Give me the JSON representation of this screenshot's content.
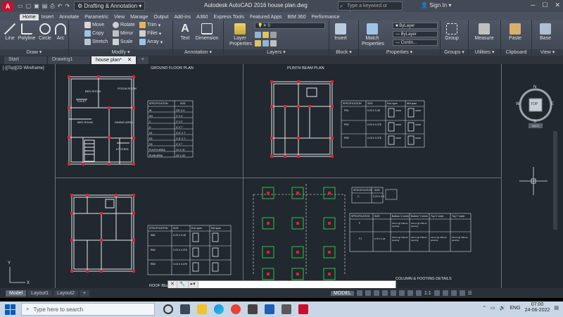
{
  "titlebar": {
    "app_logo": "A",
    "workspace": "Drafting & Annotation",
    "title": "Autodesk AutoCAD 2016    house plan.dwg",
    "search_placeholder": "Type a keyword or phrase",
    "sign_in": "Sign In"
  },
  "ribbon_tabs": [
    "Home",
    "Insert",
    "Annotate",
    "Parametric",
    "View",
    "Manage",
    "Output",
    "Add-ins",
    "A360",
    "Express Tools",
    "Featured Apps",
    "BIM 360",
    "Performance"
  ],
  "ribbon": {
    "draw": {
      "title": "Draw",
      "line": "Line",
      "polyline": "Polyline",
      "circle": "Circle",
      "arc": "Arc"
    },
    "modify": {
      "title": "Modify",
      "move": "Move",
      "copy": "Copy",
      "stretch": "Stretch",
      "rotate": "Rotate",
      "mirror": "Mirror",
      "scale": "Scale",
      "trim": "Trim",
      "fillet": "Fillet",
      "array": "Array"
    },
    "annotation": {
      "title": "Annotation",
      "text": "Text",
      "dimension": "Dimension"
    },
    "layers": {
      "title": "Layers",
      "layer_properties": "Layer Properties",
      "current_layer": "0"
    },
    "block": {
      "title": "Block",
      "insert": "Insert"
    },
    "properties": {
      "title": "Properties",
      "match": "Match Properties",
      "color": "ByLayer",
      "lineweight": "ByLayer",
      "linetype": "Contin..."
    },
    "groups": {
      "title": "Groups",
      "group": "Group"
    },
    "utilities": {
      "title": "Utilities",
      "measure": "Measure"
    },
    "clipboard": {
      "title": "Clipboard",
      "paste": "Paste"
    },
    "view": {
      "title": "View",
      "base": "Base"
    }
  },
  "file_tabs": [
    "Start",
    "Drawing1",
    "house plan*"
  ],
  "canvas": {
    "viewport_label": "[-][Top][2D Wireframe]",
    "titles": {
      "ground": "GROUND FLOOR PLAN",
      "plinth": "PLINTH BEAM PLAN",
      "roof": "ROOF BEAM PLAN",
      "column": "COLUMN & FOOTING DETAILS"
    },
    "rooms": {
      "bed_room": "BED ROOM",
      "pooja": "POOJA ROOM",
      "toilet": "TOILET",
      "bed_room2": "BED ROOM",
      "dining": "DINING AREA",
      "kitchen": "KITCHEN"
    },
    "ground_table": {
      "headers": [
        "SPECIFICATION",
        "SIZE"
      ],
      "rows": [
        [
          "W",
          "2'6\" X 4'"
        ],
        [
          "W1",
          "2' X 4'"
        ],
        [
          "V",
          "2' X 2'"
        ],
        [
          "D",
          "3' X 7'"
        ],
        [
          "D1",
          "3'-6\" X 7'"
        ],
        [
          "D2",
          "2'-6\" X 7'"
        ],
        [
          "D3",
          "3' X 7'"
        ],
        [
          "PLINTH AREA",
          "24' X 31'"
        ],
        [
          "SLAB AREA",
          "25' X 32'"
        ]
      ]
    },
    "beam_table": {
      "headers": [
        "SPECIFICATION",
        "SIZE",
        "End span",
        "Mid span"
      ],
      "rows": [
        [
          "PB1",
          "0.23 X 0.45"
        ],
        [
          "PB2",
          "0.23 X 0.375"
        ],
        [
          "PB3",
          "0.15 X 0.375"
        ]
      ]
    },
    "roof_table": {
      "headers": [
        "SPECIFICATION",
        "SIZE",
        "End span",
        "Mid span"
      ],
      "rows": [
        [
          "RB1",
          "0.23 X 0.45"
        ],
        [
          "RB2",
          "0.23 X 0.375"
        ],
        [
          "RB3",
          "0.15 X 0.375"
        ]
      ]
    },
    "column_table": {
      "headers": [
        "SPECIFICATION",
        "SIZE"
      ],
      "rows": [
        [
          "C",
          "0.23 X 0.3"
        ]
      ]
    },
    "footing_table": {
      "headers": [
        "SPECIFICATION",
        "SIZE",
        "Bottom X mesh",
        "Bottom Y mesh",
        "Top X mesh",
        "Top Y mesh"
      ],
      "rows": [
        [
          "F",
          "",
          "10mm @ 150mm spacing",
          "10mm @ 150mm spacing",
          "",
          ""
        ],
        [
          "F1",
          "0.75 X 1.05",
          "10mm @ 150mm spacing",
          "10mm @ 150mm spacing",
          "10mm @ 200mm spacing",
          "10mm @ 200mm spacing"
        ]
      ]
    },
    "viewcube": {
      "top": "TOP",
      "n": "N",
      "s": "S",
      "e": "E",
      "w": "W",
      "wcs": "WCS"
    }
  },
  "layout_tabs": [
    "Model",
    "Layout1",
    "Layout2"
  ],
  "command_placeholder": "",
  "status": {
    "model": "MODEL",
    "scale": "1:1"
  },
  "taskbar": {
    "search": "Type here to search",
    "lang": "ENG",
    "time": "07:00",
    "date": "24-06-2022"
  }
}
